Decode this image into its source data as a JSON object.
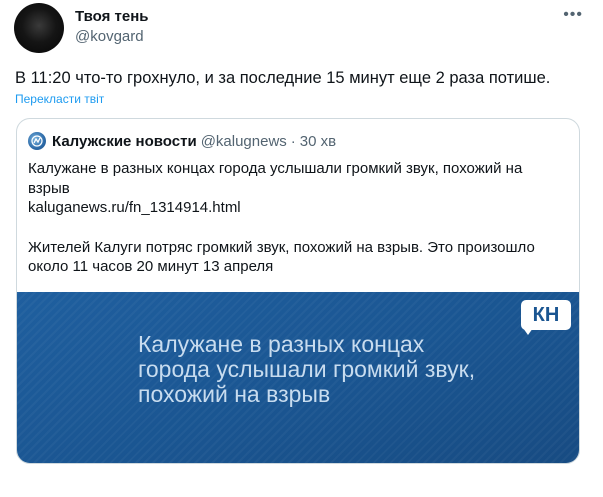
{
  "tweet": {
    "display_name": "Твоя тень",
    "handle": "@kovgard",
    "more_icon": "more-horizontal-icon",
    "text": "В 11:20 что-то грохнуло, и за последние 15 минут еще 2 раза потише.",
    "translate_label": "Перекласти твіт"
  },
  "quote": {
    "name": "Калужские новости",
    "handle": "@kalugnews",
    "separator": "·",
    "time": "30 хв",
    "headline": "Калужане в разных концах города услышали громкий звук, похожий на взрыв",
    "link": "kaluganews.ru/fn_1314914.html",
    "summary": "Жителей Калуги потряс громкий звук, похожий на взрыв. Это произошло около 11 часов 20 минут 13 апреля",
    "media": {
      "badge": "КН",
      "headline": "Калужане в разных концах города услышали громкий звук, похожий на взрыв",
      "background_color": "#1a5591"
    }
  },
  "colors": {
    "text": "#0f1419",
    "secondary": "#536471",
    "accent": "#1d9bf0",
    "border": "#cfd9de"
  }
}
